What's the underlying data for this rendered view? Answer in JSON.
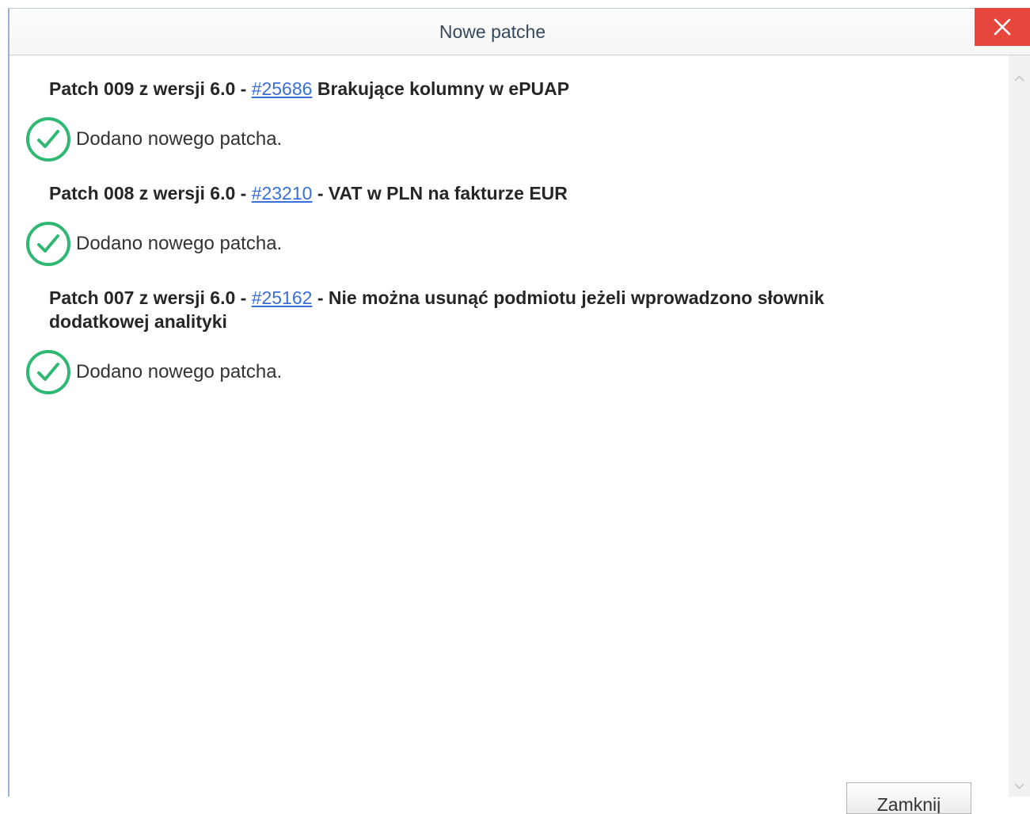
{
  "window": {
    "title": "Nowe patche",
    "close_icon": "close-icon"
  },
  "patches": [
    {
      "prefix": "Patch 009 z wersji 6.0 - ",
      "link": "#25686",
      "suffix": " Brakujące kolumny w ePUAP",
      "status": "Dodano nowego patcha.",
      "status_icon": "check-circle-icon"
    },
    {
      "prefix": "Patch 008 z wersji 6.0 - ",
      "link": "#23210",
      "suffix": " - VAT w PLN na fakturze EUR",
      "status": "Dodano nowego patcha.",
      "status_icon": "check-circle-icon"
    },
    {
      "prefix": "Patch 007 z wersji 6.0 - ",
      "link": "#25162",
      "suffix": " - Nie można usunąć podmiotu jeżeli wprowadzono słownik dodatkowej analityki",
      "status": "Dodano nowego patcha.",
      "status_icon": "check-circle-icon"
    }
  ],
  "footer": {
    "close_label": "Zamknij"
  },
  "colors": {
    "close_button": "#e5473c",
    "link": "#3a6fd8",
    "success": "#2eb872"
  }
}
